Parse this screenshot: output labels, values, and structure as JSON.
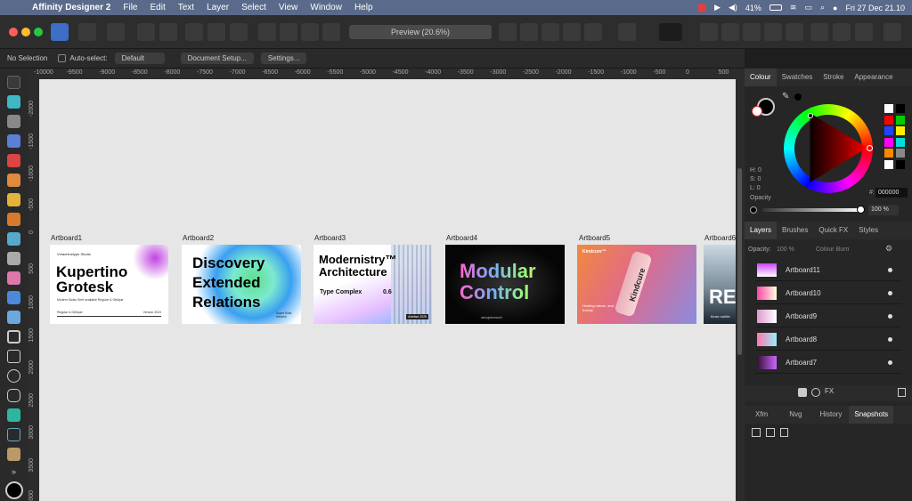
{
  "menubar": {
    "app_name": "Affinity Designer 2",
    "items": [
      "File",
      "Edit",
      "Text",
      "Layer",
      "Select",
      "View",
      "Window",
      "Help"
    ],
    "battery": "41%",
    "datetime": "Fri 27 Dec 21.10"
  },
  "toolbar": {
    "preview_label": "Preview (20.6%)"
  },
  "context": {
    "selection": "No Selection",
    "auto_select_label": "Auto-select:",
    "auto_select_value": "Default",
    "document_setup": "Document Setup...",
    "settings": "Settings..."
  },
  "ruler": {
    "unit": "px",
    "h_ticks": [
      "-10000",
      "-9500",
      "-9000",
      "-8500",
      "-8000",
      "-7500",
      "-7000",
      "-6500",
      "-6000",
      "-5500",
      "-5000",
      "-4500",
      "-4000",
      "-3500",
      "-3000",
      "-2500",
      "-2000",
      "-1500",
      "-1000",
      "-500",
      "0",
      "500"
    ],
    "v_ticks": [
      "-2000",
      "-1500",
      "-1000",
      "-500",
      "0",
      "500",
      "1000",
      "1500",
      "2000",
      "2500",
      "3000",
      "3500",
      "4000"
    ]
  },
  "artboards": [
    {
      "label": "Artboard1",
      "title": "Kupertino Grotesk",
      "top": "Vmachinetype Studio",
      "sub": "Modern Swiss Serif available Regular & Oblique",
      "foot_left": "Regular & Oblique",
      "foot_right": "Version 2024"
    },
    {
      "label": "Artboard2",
      "title": "Discovery Extended Relations",
      "foot": "Super Bold Version"
    },
    {
      "label": "Artboard3",
      "title": "Modernistry™ Architecture",
      "sub": "Type Complex",
      "num": "0.6",
      "foot": "Artefact 2025"
    },
    {
      "label": "Artboard4",
      "title": "Modular Control",
      "foot": "winogfaemacht"
    },
    {
      "label": "Artboard5",
      "title": "Kindcure",
      "brand": "Kindcure™",
      "tag": "Healing nature, and freshly"
    },
    {
      "label": "Artboard6",
      "title": "RE",
      "foot": "those subtle"
    }
  ],
  "colour_panel": {
    "tabs": [
      "Colour",
      "Swatches",
      "Stroke",
      "Appearance"
    ],
    "h": "H: 0",
    "s": "S: 0",
    "l": "L: 0",
    "hex_label": "#:",
    "hex": "000000",
    "opacity_label": "Opacity",
    "opacity_value": "100 %",
    "swatch_colors": [
      "#ffffff",
      "#000000",
      "#ff0000",
      "#00cc00",
      "#2244ff",
      "#ffee00",
      "#ff00ff",
      "#00dddd",
      "#ff8800",
      "#888888",
      "#ffffff",
      "#000000"
    ]
  },
  "layers_panel": {
    "tabs": [
      "Layers",
      "Brushes",
      "Quick FX",
      "Styles"
    ],
    "opacity_label": "Opacity:",
    "opacity_value": "100 %",
    "blend_mode": "Colour Burn",
    "items": [
      "Artboard11",
      "Artboard10",
      "Artboard9",
      "Artboard8",
      "Artboard7"
    ]
  },
  "bottom_panel": {
    "tabs": [
      "Xfm",
      "Nvg",
      "History",
      "Snapshots"
    ]
  },
  "colors": {
    "accent": "#465f7c",
    "canvas": "#e6e6e6"
  }
}
